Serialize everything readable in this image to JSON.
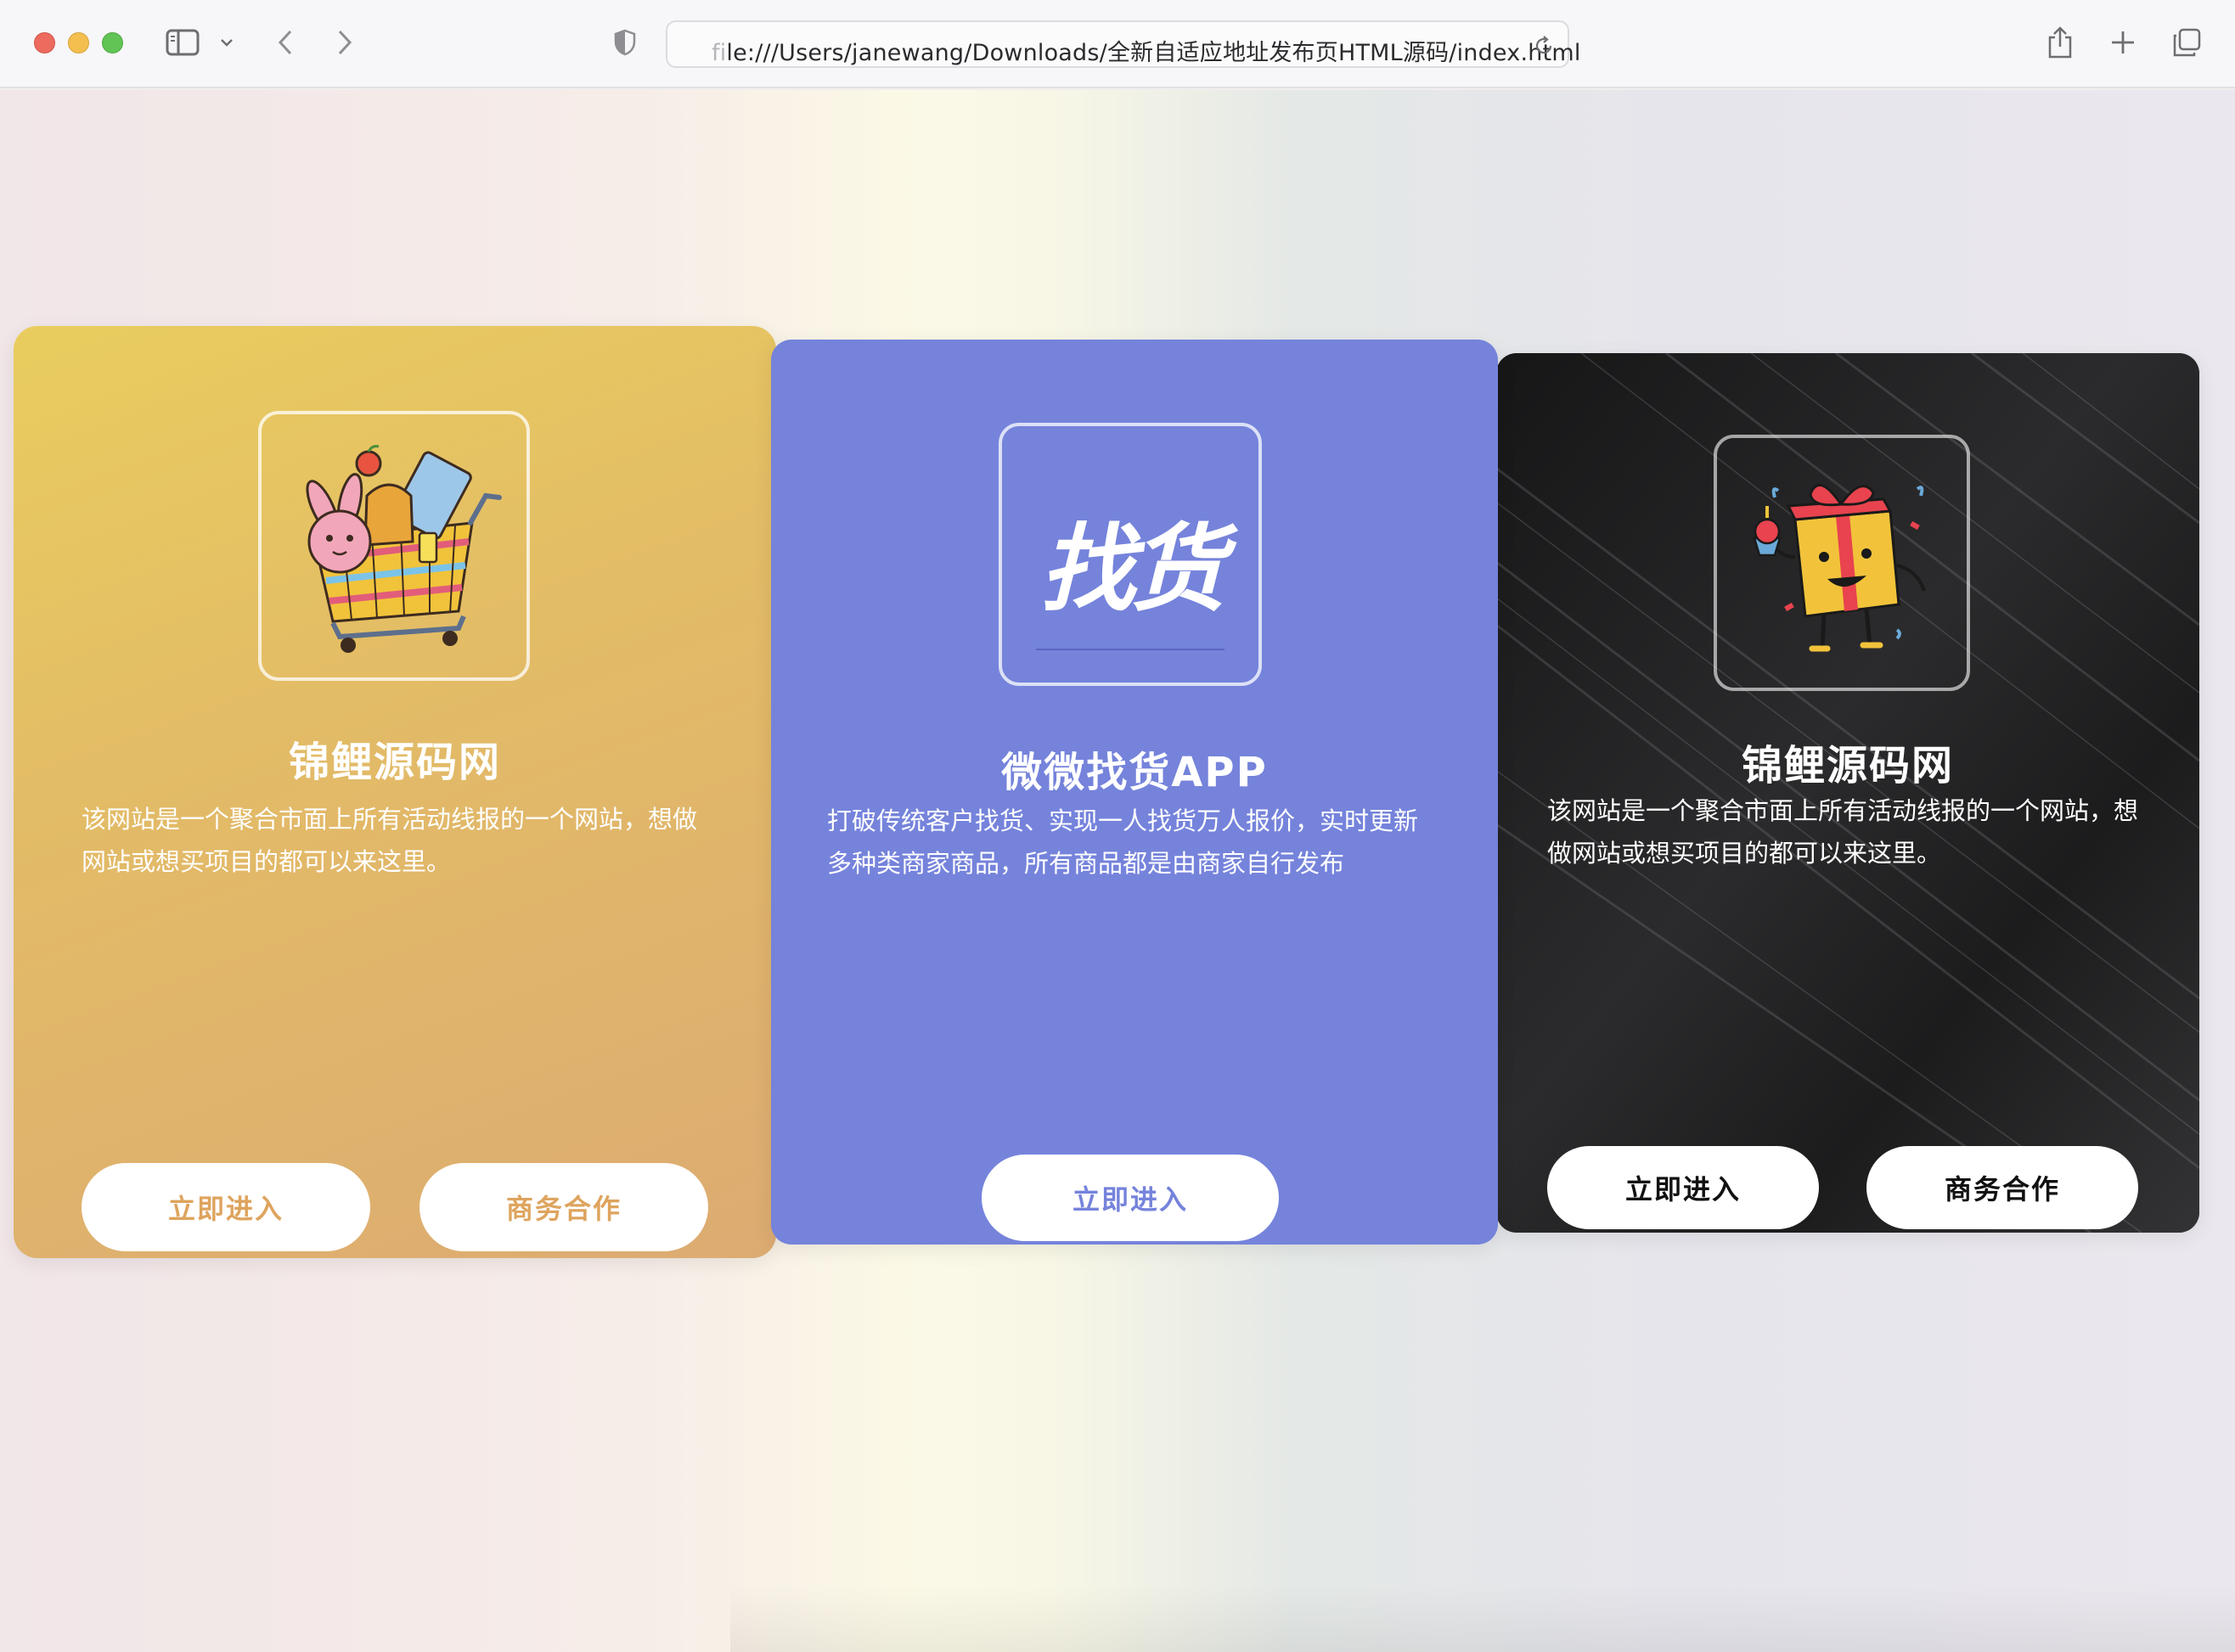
{
  "browser": {
    "url_prefix": "file:///Users/janewang/Downloads/",
    "url_prefix_dim": "fi",
    "url_prefix_rest": "le:///Users/janewang/Downloads/",
    "url_path": "全新自适应地址发布页HTML源码/index.html"
  },
  "cards": [
    {
      "title": "锦鲤源码网",
      "description": "该网站是一个聚合市面上所有活动线报的一个网站，想做网站或想买项目的都可以来这里。",
      "buttons": [
        "立即进入",
        "商务合作"
      ],
      "button_text_color": "#dea45e",
      "logo": "shopping-cart-bunny-icon"
    },
    {
      "title": "微微找货APP",
      "description": "打破传统客户找货、实现一人找货万人报价，实时更新多种类商家商品，所有商品都是由商家自行发布",
      "buttons": [
        "立即进入"
      ],
      "button_text_color": "#7583db",
      "logo_text": "找货",
      "logo": "zhaohuo-logo-icon"
    },
    {
      "title": "锦鲤源码网",
      "description": "该网站是一个聚合市面上所有活动线报的一个网站，想做网站或想买项目的都可以来这里。",
      "buttons": [
        "立即进入",
        "商务合作"
      ],
      "button_text_color": "#111111",
      "logo": "gift-box-character-icon"
    }
  ]
}
